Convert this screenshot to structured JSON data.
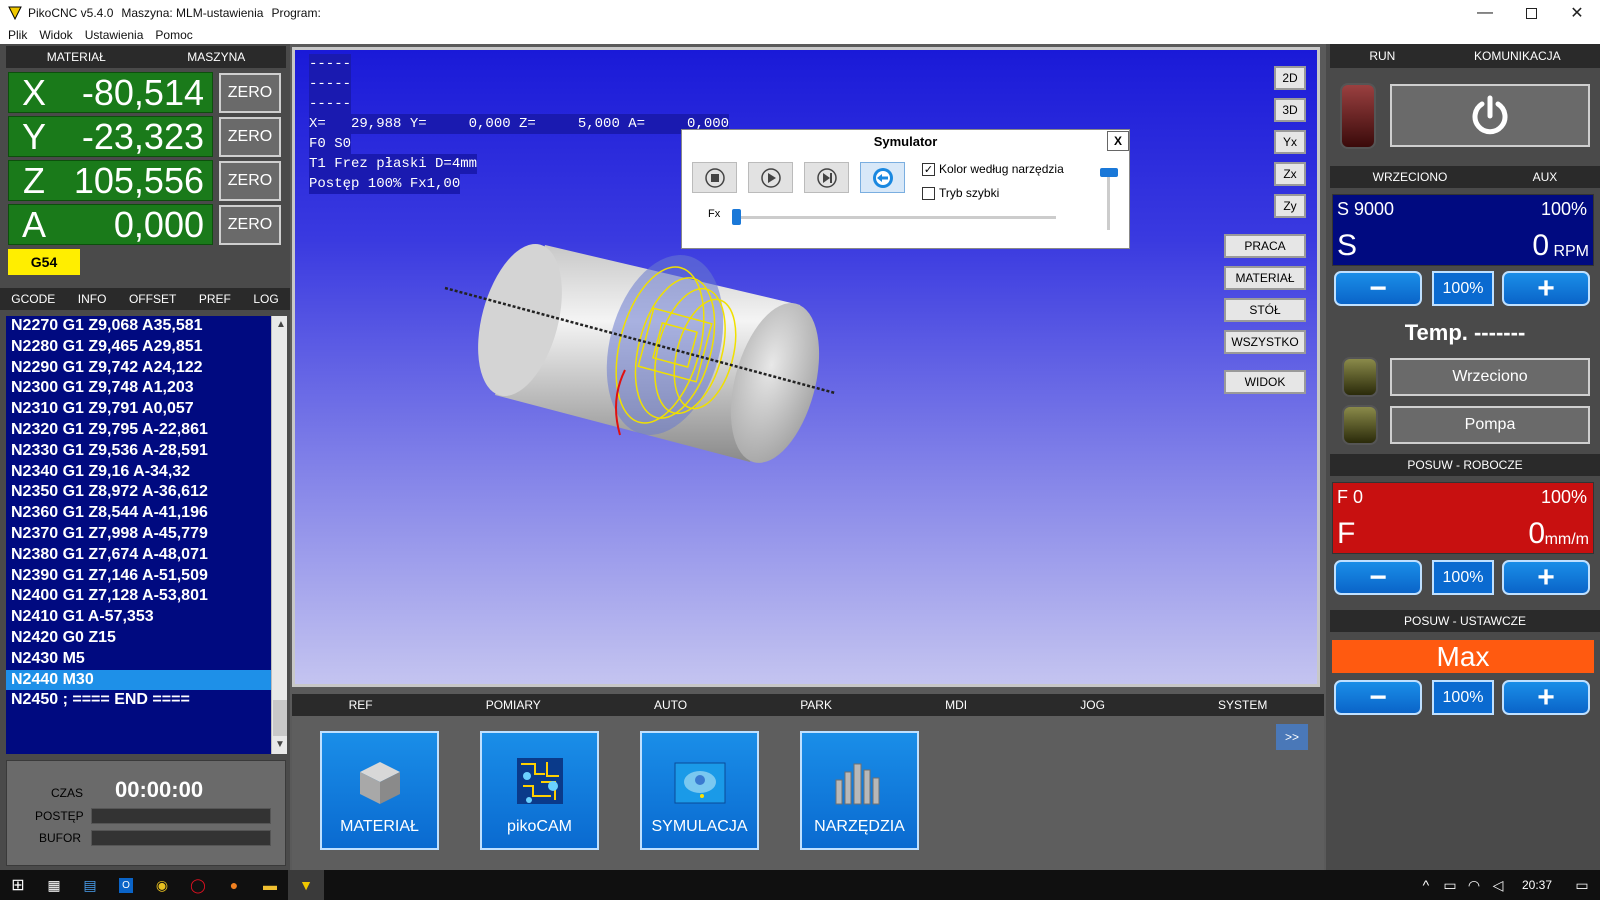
{
  "window": {
    "app": "PikoCNC v5.4.0",
    "machine": "Maszyna: MLM-ustawienia",
    "program": "Program:"
  },
  "menu": [
    "Plik",
    "Widok",
    "Ustawienia",
    "Pomoc"
  ],
  "left_header": {
    "material": "MATERIAŁ",
    "machine": "MASZYNA"
  },
  "dro": [
    {
      "axis": "X",
      "value": "-80,514",
      "zero": "ZERO"
    },
    {
      "axis": "Y",
      "value": "-23,323",
      "zero": "ZERO"
    },
    {
      "axis": "Z",
      "value": "105,556",
      "zero": "ZERO"
    },
    {
      "axis": "A",
      "value": "0,000",
      "zero": "ZERO"
    }
  ],
  "wcs": "G54",
  "gcode_tabs": [
    "GCODE",
    "INFO",
    "OFFSET",
    "PREF",
    "LOG"
  ],
  "gcode_lines": [
    "N2270 G1 Z9,068 A35,581",
    "N2280 G1 Z9,465 A29,851",
    "N2290 G1 Z9,742 A24,122",
    "N2300 G1 Z9,748 A1,203",
    "N2310 G1 Z9,791 A0,057",
    "N2320 G1 Z9,795 A-22,861",
    "N2330 G1 Z9,536 A-28,591",
    "N2340 G1 Z9,16 A-34,32",
    "N2350 G1 Z8,972 A-36,612",
    "N2360 G1 Z8,544 A-41,196",
    "N2370 G1 Z7,998 A-45,779",
    "N2380 G1 Z7,674 A-48,071",
    "N2390 G1 Z7,146 A-51,509",
    "N2400 G1 Z7,128 A-53,801",
    "N2410 G1 A-57,353",
    "N2420 G0 Z15",
    "N2430 M5",
    "N2440 M30",
    "N2450 ; ==== END ===="
  ],
  "gcode_selected_index": 17,
  "status": {
    "time_label": "CZAS",
    "time_value": "00:00:00",
    "progress_label": "POSTĘP",
    "buffer_label": "BUFOR"
  },
  "viewport": {
    "lines": [
      "-----",
      "-----",
      "-----"
    ],
    "coords": "X=   29,988 Y=     0,000 Z=     5,000 A=     0,000",
    "feed": "F0 S0",
    "tool": "T1 Frez płaski D=4mm",
    "progress": "Postęp 100% Fx1,00"
  },
  "view_buttons": [
    "2D",
    "3D",
    "Yx",
    "Zx",
    "Zy"
  ],
  "zoom_buttons": [
    "PRACA",
    "MATERIAŁ",
    "STÓŁ",
    "WSZYSTKO"
  ],
  "view_button": "WIDOK",
  "simulator": {
    "title": "Symulator",
    "close": "X",
    "chk_color": "Kolor według narzędzia",
    "chk_fast": "Tryb szybki",
    "fx_label": "Fx",
    "chk_color_checked": true,
    "chk_fast_checked": false
  },
  "bottom_tabs": [
    "REF",
    "POMIARY",
    "AUTO",
    "PARK",
    "MDI",
    "JOG",
    "SYSTEM"
  ],
  "more_button": ">>",
  "big_buttons": [
    {
      "label": "MATERIAŁ",
      "icon": "cube-icon"
    },
    {
      "label": "pikoCAM",
      "icon": "circuit-icon"
    },
    {
      "label": "SYMULACJA",
      "icon": "simulation-icon"
    },
    {
      "label": "NARZĘDZIA",
      "icon": "tools-icon"
    }
  ],
  "right": {
    "run_tabs": [
      "RUN",
      "KOMUNIKACJA"
    ],
    "spindle_tabs": [
      "WRZECIONO",
      "AUX"
    ],
    "spindle": {
      "set": "S 9000",
      "pct": "100%",
      "letter": "S",
      "value": "0",
      "unit": "RPM"
    },
    "pct_button": "100%",
    "temp": "Temp. -------",
    "spindle_btn": "Wrzeciono",
    "pump_btn": "Pompa",
    "feed_header": "POSUW - ROBOCZE",
    "feed": {
      "set": "F 0",
      "pct": "100%",
      "letter": "F",
      "value": "0",
      "unit": "mm/m"
    },
    "rapid_header": "POSUW - USTAWCZE",
    "rapid_value": "Max"
  },
  "taskbar": {
    "time": "20:37"
  },
  "colors": {
    "dro_green": "#1a7a1a",
    "gcode_blue": "#000a80",
    "highlight": "#1e90e8",
    "feed_red": "#c81010",
    "rapid_orange": "#ff5a10",
    "wcs_yellow": "#ffee00"
  }
}
